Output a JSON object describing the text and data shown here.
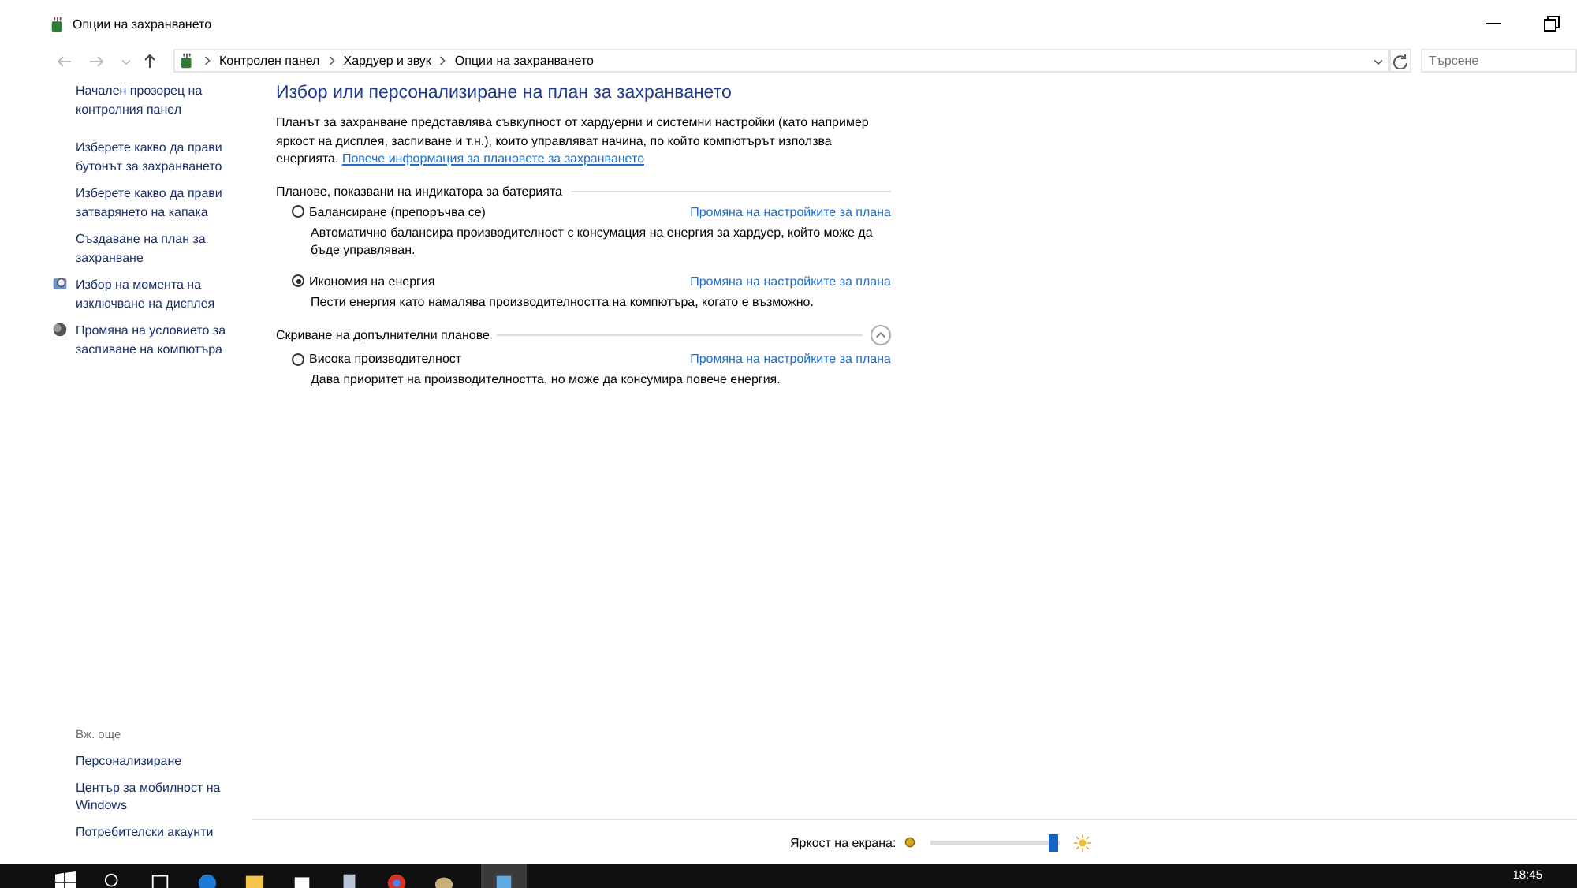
{
  "window": {
    "title": "Опции на захранването"
  },
  "address_bar": {
    "crumbs": [
      "Контролен панел",
      "Хардуер и звук",
      "Опции на захранването"
    ],
    "search_placeholder": "Търсене"
  },
  "sidebar": {
    "items": [
      {
        "label": "Начален прозорец на контролния панел",
        "kind": "home"
      },
      {
        "label": "Изберете какво да прави бутонът за захранването",
        "kind": "link"
      },
      {
        "label": "Изберете какво да прави затварянето на капака",
        "kind": "link"
      },
      {
        "label": "Създаване на план за захранване",
        "kind": "link"
      },
      {
        "label": "Избор на момента на изключване на дисплея",
        "kind": "monitor"
      },
      {
        "label": "Промяна на условието за заспиване на компютъра",
        "kind": "moon"
      }
    ],
    "see_also_title": "Вж. още",
    "see_also": [
      "Персонализиране",
      "Център за мобилност на Windows",
      "Потребителски акаунти"
    ]
  },
  "main": {
    "title": "Избор или персонализиране на план за захранването",
    "intro": "Планът за захранване представлява съвкупност от хардуерни и системни настройки  (като например яркост на дисплея, заспиване и т.н.), които управляват начина, по който компютърът използва енергията.",
    "intro_link": "Повече информация за плановете за захранването",
    "groups": [
      {
        "title": "Планове, показвани на индикатора за батерията",
        "collapsible": false,
        "plans": [
          {
            "name": "Балансиране (препоръчва се)",
            "selected": false,
            "link": "Промяна на настройките за плана",
            "description": "Автоматично балансира производителност с консумация на енергия за хардуер, който може да бъде управляван."
          },
          {
            "name": "Икономия на енергия",
            "selected": true,
            "link": "Промяна на настройките за плана",
            "description": "Пести енергия като намалява производителността на компютъра, когато е възможно."
          }
        ]
      },
      {
        "title": "Скриване на допълнителни планове",
        "collapsible": true,
        "plans": [
          {
            "name": "Висока производителност",
            "selected": false,
            "link": "Промяна на настройките за плана",
            "description": "Дава приоритет на производителността, но може да консумира повече енергия."
          }
        ]
      }
    ]
  },
  "brightness": {
    "label": "Яркост на екрана:",
    "level": 0.95
  },
  "taskbar": {
    "clock": "18:45"
  }
}
